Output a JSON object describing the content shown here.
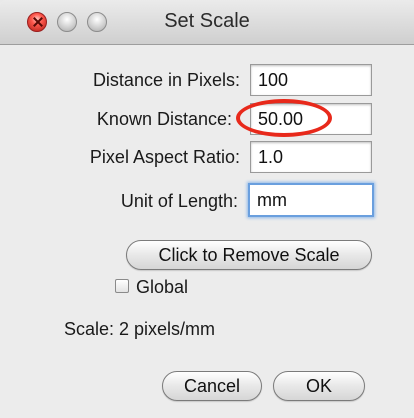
{
  "window": {
    "title": "Set Scale"
  },
  "fields": {
    "distance_in_pixels": {
      "label": "Distance in Pixels:",
      "value": "100"
    },
    "known_distance": {
      "label": "Known Distance:",
      "value": "50.00"
    },
    "pixel_aspect_ratio": {
      "label": "Pixel Aspect Ratio:",
      "value": "1.0"
    },
    "unit_of_length": {
      "label": "Unit of Length:",
      "value": "mm"
    }
  },
  "remove_scale_button": {
    "label": "Click to Remove Scale"
  },
  "global_checkbox": {
    "label": "Global",
    "checked": false
  },
  "scale_status": "Scale: 2 pixels/mm",
  "buttons": {
    "cancel": "Cancel",
    "ok": "OK"
  },
  "colors": {
    "annotation_circle": "#e8291b",
    "focus_ring": "#6a9fde"
  }
}
